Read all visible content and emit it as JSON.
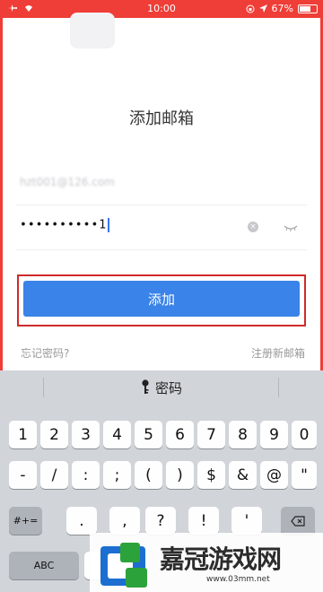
{
  "status_bar": {
    "time": "10:00",
    "battery": "67%",
    "battery_level": 0.67,
    "left_icons": [
      "airplane-icon",
      "wifi-icon"
    ],
    "right_icons": [
      "lock-rotation-icon",
      "location-icon"
    ],
    "bar_color": "#ef3d37"
  },
  "form": {
    "title": "添加邮箱",
    "email_value": "hzt001@126.com",
    "password_value": "••••••••••1",
    "submit_label": "添加",
    "forgot_label": "忘记密码?",
    "register_label": "注册新邮箱",
    "accent": "#3a83e8",
    "highlight_color": "#cf2a2a"
  },
  "keyboard": {
    "header_label": "密码",
    "row1": [
      "1",
      "2",
      "3",
      "4",
      "5",
      "6",
      "7",
      "8",
      "9",
      "0"
    ],
    "row2": [
      "-",
      "/",
      ":",
      ";",
      "(",
      ")",
      "$",
      "&",
      "@",
      "\""
    ],
    "row3_left": "#+=",
    "row3": [
      ".",
      ",",
      "?",
      "!",
      "'"
    ],
    "row4_left": "ABC"
  },
  "watermark": {
    "title": "嘉冠游戏网",
    "url": "www.03mm.net"
  }
}
